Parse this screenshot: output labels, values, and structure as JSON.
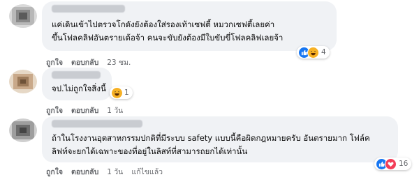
{
  "comments": [
    {
      "text_lines": [
        "แค่เดินเข้าไปตรวจโกดังยังต้องใส่รองเท้าเซฟตี้ หมวกเซฟตี้เลยค่า",
        "ขึ้นโฟลคลิฟอันตรายเด้อจ้า คนจะขับยังต้องมีใบขับขี่โฟลคลิฟเลยจ้า"
      ],
      "like": "ถูกใจ",
      "reply": "ตอบกลับ",
      "time": "23 ชม.",
      "reaction_count": "4",
      "reaction_icons": [
        "like-icon",
        "haha-icon"
      ]
    },
    {
      "text_lines": [
        "จป.ไม่ถูกใจสิ่งนี้"
      ],
      "like": "ถูกใจ",
      "reply": "ตอบกลับ",
      "time": "1 วัน",
      "reaction_count": "1",
      "reaction_icons": [
        "haha-icon"
      ]
    },
    {
      "text_lines": [
        "ถ้าในโรงงานอุตสาหกรรมปกติที่มีระบบ safety แบบนี้คือผิดกฎหมายครับ อันตรายมาก โฟล์ค",
        "ลิฟท์จะยกได้เฉพาะของที่อยู่ในลิสท์ที่สามารถยกได้เท่านั้น"
      ],
      "like": "ถูกใจ",
      "reply": "ตอบกลับ",
      "time": "1 วัน",
      "edited": "แก้ไขแล้ว",
      "reaction_count": "16",
      "reaction_icons": [
        "like-icon",
        "love-icon"
      ]
    }
  ],
  "colors": {
    "bubble": "#f0f2f5",
    "like_blue": "#1877f2",
    "love_red": "#f33e58",
    "haha_yellow": "#f7b125",
    "meta_gray": "#65676b"
  }
}
